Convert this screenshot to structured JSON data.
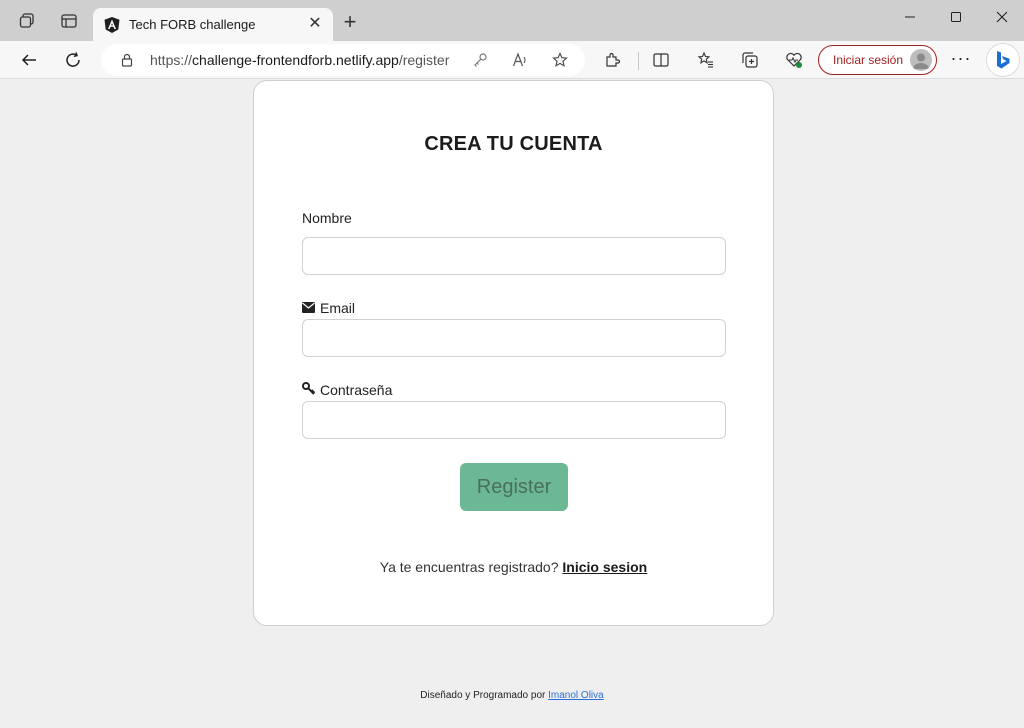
{
  "browser": {
    "tab_title": "Tech FORB challenge",
    "url_prefix": "https://",
    "url_host": "challenge-frontendforb.netlify.app",
    "url_path": "/register",
    "signin_label": "Iniciar sesión",
    "accent": "#a12020"
  },
  "form": {
    "title": "CREA TU CUENTA",
    "name_label": "Nombre",
    "email_label": "Email",
    "password_label": "Contraseña",
    "name_value": "",
    "email_value": "",
    "password_value": "",
    "submit_label": "Register",
    "submit_color": "#6cb894"
  },
  "login_prompt": {
    "text": "Ya te encuentras registrado?",
    "link": "Inicio sesion"
  },
  "credit": {
    "text": "Diseñado y Programado por",
    "author": "Imanol Oliva"
  }
}
